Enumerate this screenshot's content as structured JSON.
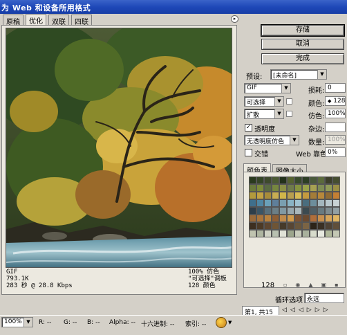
{
  "window": {
    "title": "为 Web 和设备所用格式"
  },
  "tabs": [
    {
      "label": "原稿",
      "active": false
    },
    {
      "label": "优化",
      "active": true
    },
    {
      "label": "双联",
      "active": false
    },
    {
      "label": "四联",
      "active": false
    }
  ],
  "image_info": {
    "format": "GIF",
    "size": "793.1K",
    "time": "283 秒 @ 28.8 Kbps",
    "dither": "100% 仿色",
    "palette": "\"可选择\"调板",
    "colors": "128 颜色"
  },
  "buttons": {
    "save": "存储",
    "cancel": "取消",
    "done": "完成"
  },
  "settings": {
    "preset_label": "预设:",
    "preset_value": "[未命名]",
    "format_value": "GIF",
    "reduction_value": "可选择",
    "dither_algo_value": "扩散",
    "lossy_label": "损耗:",
    "lossy_value": "0",
    "colors_label": "颜色:",
    "colors_value": "128",
    "dither_label": "仿色:",
    "dither_value": "100%",
    "transparency_label": "透明度",
    "transparency_checked": true,
    "matte_label": "杂边:",
    "transparency_dither_value": "无透明度仿色",
    "amount_label": "数量:",
    "amount_value": "100%",
    "interlace_label": "交错",
    "interlace_checked": false,
    "websnap_label": "Web 靠色:",
    "websnap_value": "0%"
  },
  "color_table": {
    "tab_colors": "颜色表",
    "tab_size": "图像大小",
    "count": "128",
    "swatches": [
      "#2a3a1e",
      "#354526",
      "#3e4a2c",
      "#4b5a33",
      "#23311a",
      "#55622f",
      "#384a2b",
      "#2d3e24",
      "#4a5a3a",
      "#5b6a3c",
      "#3c3f2a",
      "#464e30",
      "#6b7a3c",
      "#7c8a3a",
      "#5a6b42",
      "#76863f",
      "#8a8f45",
      "#6f7b4a",
      "#85933f",
      "#9aa24a",
      "#a6a152",
      "#7e8c54",
      "#8f9a58",
      "#9b8f45",
      "#b39a3c",
      "#c3a343",
      "#a88c3a",
      "#c8ad52",
      "#d1b54a",
      "#b89e4f",
      "#d8bb55",
      "#c49a3f",
      "#a47c38",
      "#b7883b",
      "#8f6b34",
      "#c47f34",
      "#3f6f8c",
      "#4f86a3",
      "#6aa0b8",
      "#5f7f9a",
      "#7a9fb0",
      "#89b3c4",
      "#9fc2d0",
      "#4a6d7e",
      "#6d8e9c",
      "#a3b6bd",
      "#b8c7cc",
      "#c8d2d4",
      "#2e3e4a",
      "#3a5566",
      "#58707c",
      "#6c7f86",
      "#8199a3",
      "#98a8ae",
      "#aab8bc",
      "#3b4a50",
      "#4f5f66",
      "#687a80",
      "#7e8c90",
      "#92a0a4",
      "#9a6a3a",
      "#a8743c",
      "#b8823e",
      "#8e5e34",
      "#c08a4a",
      "#d09a4c",
      "#7e5332",
      "#6a4a30",
      "#b06e3a",
      "#c7904f",
      "#d6a55a",
      "#e0b664",
      "#3d2f20",
      "#4c3a26",
      "#5d4630",
      "#6f5536",
      "#463a2a",
      "#574634",
      "#69563c",
      "#7b6444",
      "#2c2419",
      "#3a3024",
      "#4e4234",
      "#604f3a",
      "#c0c4b0",
      "#aeb5a0",
      "#d0d2c4",
      "#b8c0b0",
      "#e0e2d6",
      "#9ca58c",
      "#c9ccbc",
      "#a8b09c",
      "#d8dccc",
      "#e8eae0",
      "#b0b89a",
      "#c4c8b4"
    ]
  },
  "loop": {
    "label": "循环选项",
    "value": "永远",
    "frame": "第1, 共15"
  },
  "status": {
    "zoom": "100%",
    "r": "R: --",
    "g": "G: --",
    "b": "B: --",
    "alpha": "Alpha: --",
    "hex": "十六进制: --",
    "index": "索引: --"
  }
}
